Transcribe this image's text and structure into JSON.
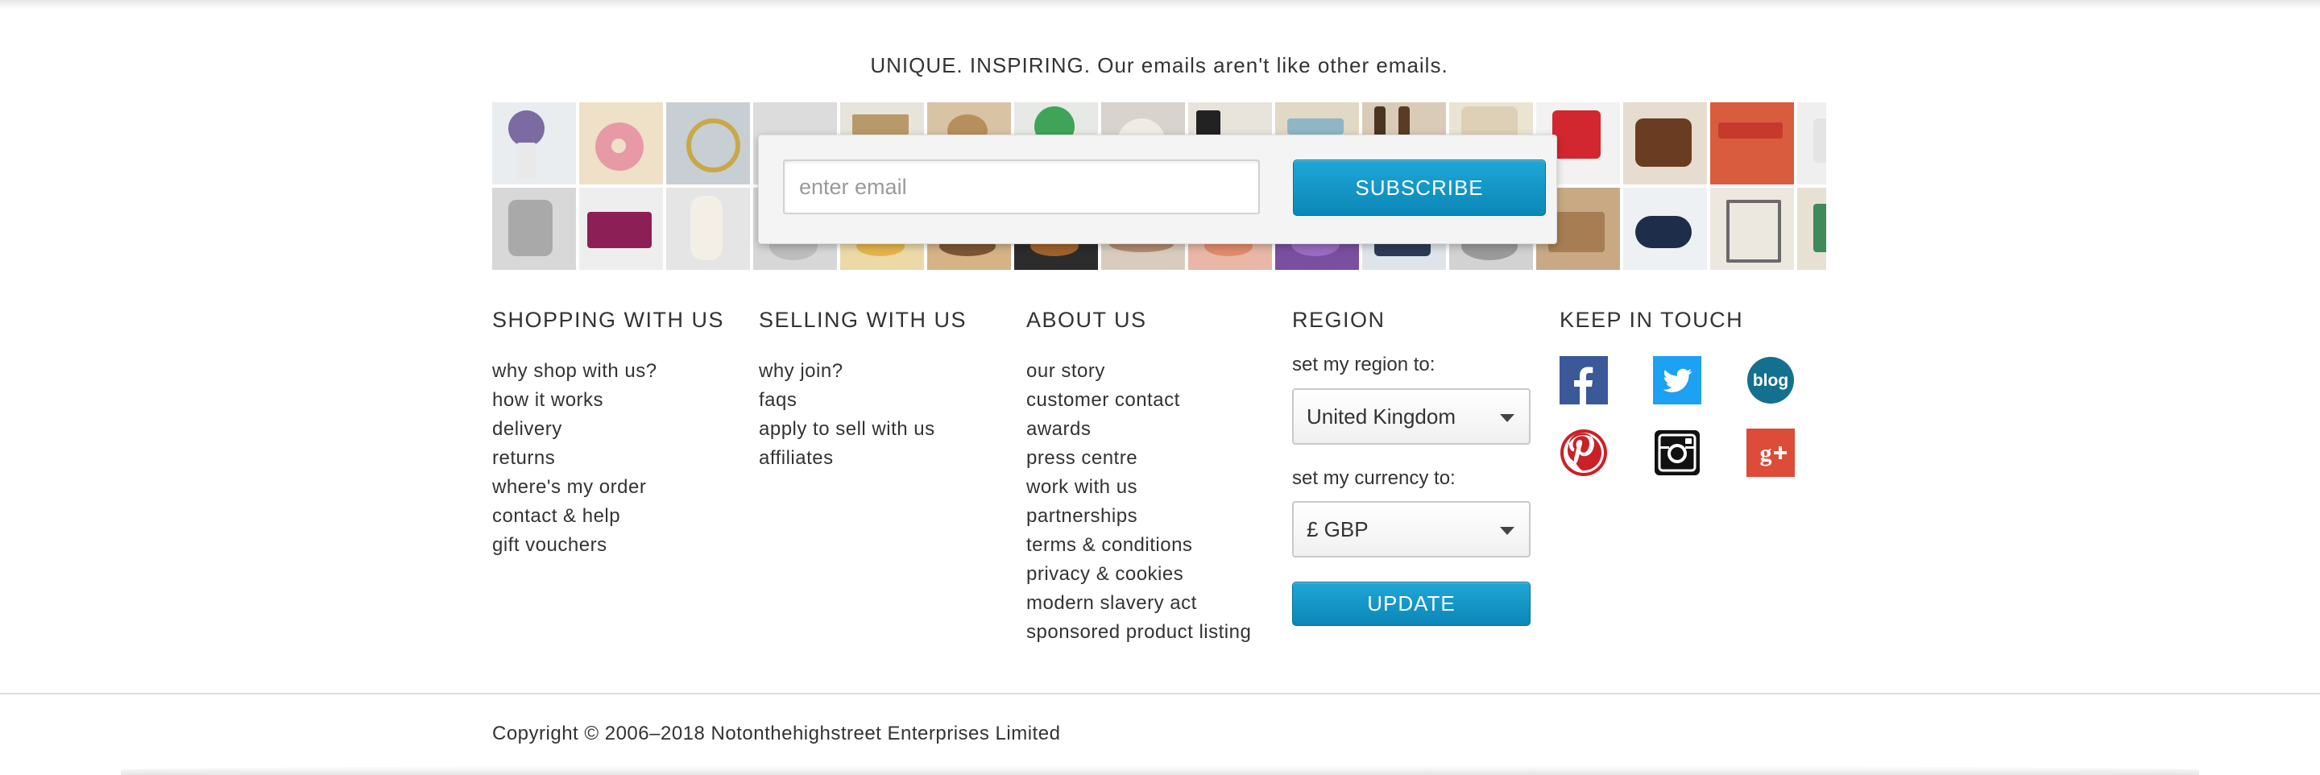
{
  "newsletter": {
    "tagline": "UNIQUE. INSPIRING. Our emails aren't like other emails.",
    "email_placeholder": "enter email",
    "subscribe_label": "SUBSCRIBE"
  },
  "footer": {
    "shopping": {
      "heading": "SHOPPING WITH US",
      "links": [
        "why shop with us?",
        "how it works",
        "delivery",
        "returns",
        "where's my order",
        "contact & help",
        "gift vouchers"
      ]
    },
    "selling": {
      "heading": "SELLING WITH US",
      "links": [
        "why join?",
        "faqs",
        "apply to sell with us",
        "affiliates"
      ]
    },
    "about": {
      "heading": "ABOUT US",
      "links": [
        "our story",
        "customer contact",
        "awards",
        "press centre",
        "work with us",
        "partnerships",
        "terms & conditions",
        "privacy & cookies",
        "modern slavery act",
        "sponsored product listing"
      ]
    },
    "region": {
      "heading": "REGION",
      "region_label": "set my region to:",
      "region_value": "United Kingdom",
      "currency_label": "set my currency to:",
      "currency_value": "£ GBP",
      "update_label": "UPDATE"
    },
    "keep_in_touch": {
      "heading": "KEEP IN TOUCH",
      "icons": [
        "facebook-icon",
        "twitter-icon",
        "blog-icon",
        "pinterest-icon",
        "instagram-icon",
        "google-plus-icon"
      ]
    }
  },
  "copyright": "Copyright © 2006–2018 Notonthehighstreet Enterprises Limited",
  "colors": {
    "button_blue": "#1393c4",
    "facebook": "#3b5998",
    "twitter": "#1da1f2",
    "blog": "#14708f",
    "pinterest": "#cb2027",
    "instagram": "#111111",
    "google_plus": "#dd4b39"
  }
}
